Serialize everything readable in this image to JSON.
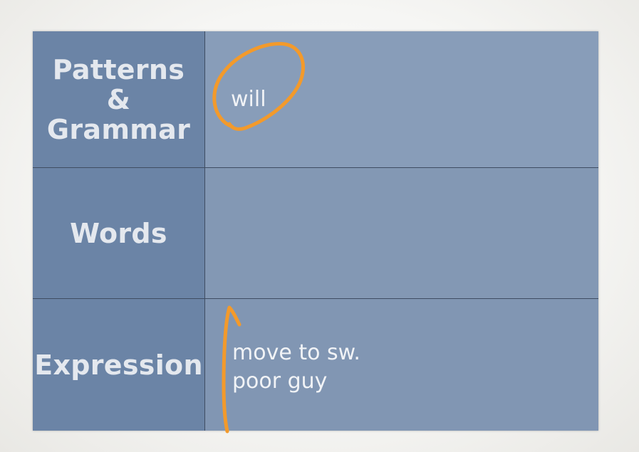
{
  "table": {
    "rows": [
      {
        "label": "Patterns\n&\nGrammar",
        "notes": [
          "will"
        ]
      },
      {
        "label": "Words",
        "notes": []
      },
      {
        "label": "Expression",
        "notes": [
          "move to sw.",
          "poor guy"
        ]
      }
    ]
  },
  "annotations": {
    "ink_color": "#f39a2b"
  }
}
